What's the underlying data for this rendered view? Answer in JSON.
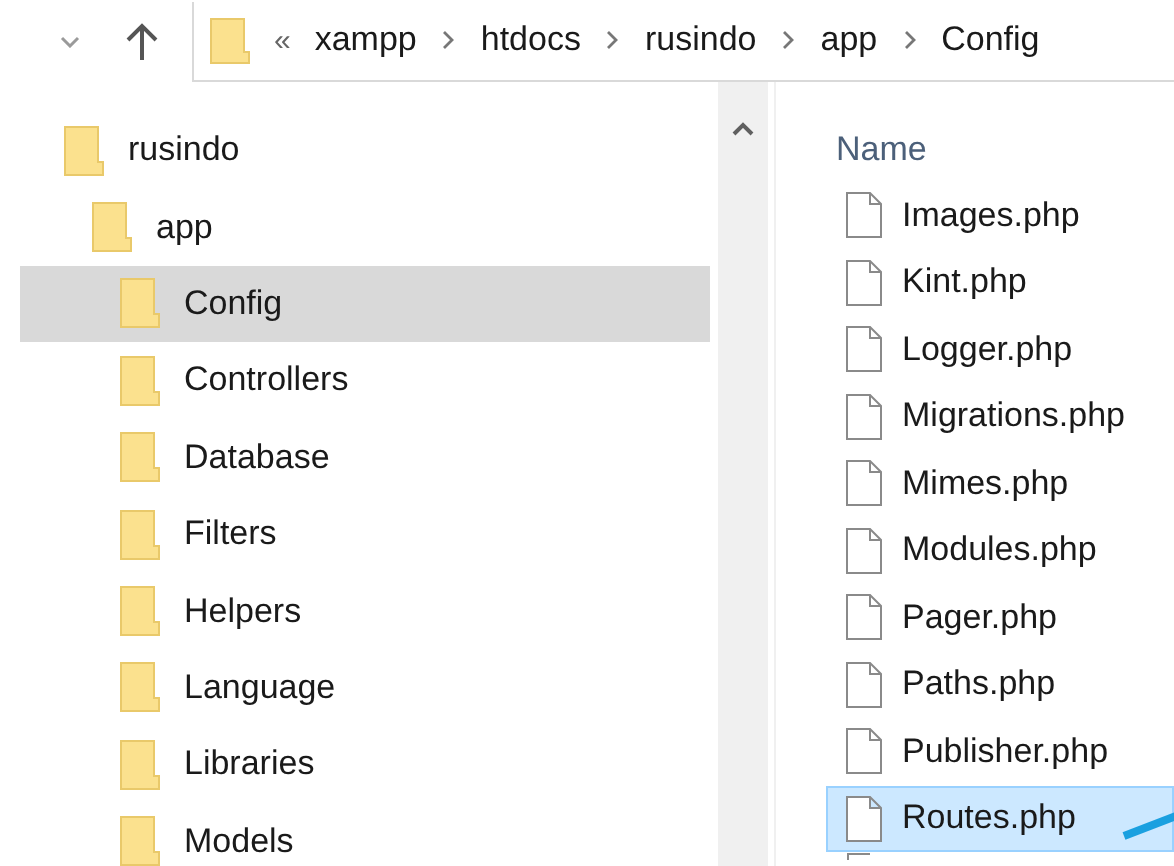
{
  "address_bar": {
    "overflow": "«",
    "segments": [
      "xampp",
      "htdocs",
      "rusindo",
      "app",
      "Config"
    ]
  },
  "tree": [
    {
      "label": "rusindo",
      "selected": false,
      "children": [
        {
          "label": "app",
          "selected": false,
          "children": [
            {
              "label": "Config",
              "selected": true
            },
            {
              "label": "Controllers",
              "selected": false
            },
            {
              "label": "Database",
              "selected": false
            },
            {
              "label": "Filters",
              "selected": false
            },
            {
              "label": "Helpers",
              "selected": false
            },
            {
              "label": "Language",
              "selected": false
            },
            {
              "label": "Libraries",
              "selected": false
            },
            {
              "label": "Models",
              "selected": false
            }
          ]
        }
      ]
    }
  ],
  "file_list": {
    "columns": [
      "Name"
    ],
    "files": [
      {
        "name": "Images.php",
        "selected": false
      },
      {
        "name": "Kint.php",
        "selected": false
      },
      {
        "name": "Logger.php",
        "selected": false
      },
      {
        "name": "Migrations.php",
        "selected": false
      },
      {
        "name": "Mimes.php",
        "selected": false
      },
      {
        "name": "Modules.php",
        "selected": false
      },
      {
        "name": "Pager.php",
        "selected": false
      },
      {
        "name": "Paths.php",
        "selected": false
      },
      {
        "name": "Publisher.php",
        "selected": false
      },
      {
        "name": "Routes.php",
        "selected": true
      }
    ]
  }
}
